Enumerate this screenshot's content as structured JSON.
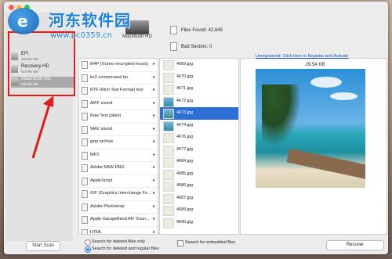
{
  "watermark": {
    "title": "河东软件园",
    "url": "www.pc0359.cn"
  },
  "sidebar": {
    "drives": [
      {
        "name": "EFI",
        "size": "209.65 MB"
      },
      {
        "name": "Recovery HD",
        "size": "619.98 MB"
      },
      {
        "name": "Macintosh HD",
        "size": "499.05 GB"
      }
    ],
    "start_scan_label": "Start Scan"
  },
  "header": {
    "drive_label": "Macintosh HD",
    "files_found": "Files Found:  42,645",
    "bad_sectors": "Bad Sectors: 0"
  },
  "file_types": [
    {
      "label": "M4P (iTunes encrypted music)",
      "chevron": true
    },
    {
      "label": "bz2 compressed tar",
      "chevron": true
    },
    {
      "label": "RTF (Rich Text Format) text",
      "chevron": true
    },
    {
      "label": "AIFF sound",
      "chevron": true
    },
    {
      "label": "Raw Text (plain)",
      "chevron": true
    },
    {
      "label": "WAV sound",
      "chevron": true
    },
    {
      "label": "gzip archive",
      "chevron": true
    },
    {
      "label": "MP3",
      "chevron": true
    },
    {
      "label": "Adobe RAW DNG",
      "chevron": true
    },
    {
      "label": "AppleScript",
      "chevron": true
    },
    {
      "label": "GIF (Graphics Interchange Fo...",
      "chevron": true
    },
    {
      "label": "Adobe Photoshop",
      "chevron": true
    },
    {
      "label": "Apple GarageBand AIF Soun...",
      "chevron": true
    },
    {
      "label": "HTML",
      "chevron": true
    }
  ],
  "files": [
    {
      "name": "4669.jpg"
    },
    {
      "name": "4670.jpg"
    },
    {
      "name": "4671.jpg"
    },
    {
      "name": "4672.jpg"
    },
    {
      "name": "4673.jpg",
      "selected": true
    },
    {
      "name": "4674.jpg"
    },
    {
      "name": "4676.jpg"
    },
    {
      "name": "4677.jpg"
    },
    {
      "name": "4684.jpg"
    },
    {
      "name": "4685.jpg"
    },
    {
      "name": "4686.jpg"
    },
    {
      "name": "4687.jpg"
    },
    {
      "name": "4689.jpg"
    },
    {
      "name": "4690.jpg"
    }
  ],
  "preview": {
    "register_link": "Unregistered: Click here to Register and Activate",
    "file_size": "29.54 KB"
  },
  "options": {
    "deleted_only": "Search for deleted files only",
    "deleted_and_regular": "Search for deleted and regular files",
    "embedded": "Search for embedded files",
    "recover_label": "Recover"
  },
  "colors": {
    "selection": "#2e6fd6",
    "highlight_box": "#e21b1b",
    "link": "#1452c8"
  }
}
